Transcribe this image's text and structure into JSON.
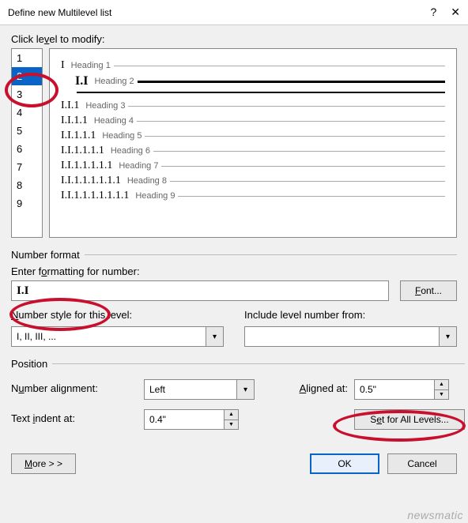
{
  "title": "Define new Multilevel list",
  "level_label_pre": "Click le",
  "level_label_u": "v",
  "level_label_post": "el to modify:",
  "levels": [
    "1",
    "2",
    "3",
    "4",
    "5",
    "6",
    "7",
    "8",
    "9"
  ],
  "selected_level": "2",
  "preview": [
    {
      "indent": 0,
      "num": "I",
      "text": "Heading 1",
      "bold": false,
      "lineBold": false
    },
    {
      "indent": 18,
      "num": "I.I",
      "text": "Heading 2",
      "bold": true,
      "lineBold": true
    },
    {
      "indent": 0,
      "num": "I.I.1",
      "text": "Heading 3",
      "bold": false,
      "lineBold": false
    },
    {
      "indent": 0,
      "num": "I.I.1.1",
      "text": "Heading 4",
      "bold": false,
      "lineBold": false
    },
    {
      "indent": 0,
      "num": "I.I.1.1.1",
      "text": "Heading 5",
      "bold": false,
      "lineBold": false
    },
    {
      "indent": 0,
      "num": "I.I.1.1.1.1",
      "text": "Heading 6",
      "bold": false,
      "lineBold": false
    },
    {
      "indent": 0,
      "num": "I.I.1.1.1.1.1",
      "text": "Heading 7",
      "bold": false,
      "lineBold": false
    },
    {
      "indent": 0,
      "num": "I.I.1.1.1.1.1.1",
      "text": "Heading 8",
      "bold": false,
      "lineBold": false
    },
    {
      "indent": 0,
      "num": "I.I.1.1.1.1.1.1.1",
      "text": "Heading 9",
      "bold": false,
      "lineBold": false
    }
  ],
  "group_number_format": "Number format",
  "enter_formatting_pre": "Enter f",
  "enter_formatting_u": "o",
  "enter_formatting_post": "rmatting for number:",
  "format_value": "I.I",
  "font_u": "F",
  "font_post": "ont...",
  "num_style_u": "N",
  "num_style_post": "umber style for this level:",
  "num_style_value": "I, II, III, ...",
  "include_label": "Include level number from:",
  "include_value": "",
  "group_position": "Position",
  "num_align_label": "Number alignment:",
  "num_align_u": "u",
  "num_align_value": "Left",
  "aligned_u": "A",
  "aligned_post": "ligned at:",
  "aligned_value": "0.5\"",
  "text_indent_label_pre": "Text ",
  "text_indent_u": "i",
  "text_indent_label_post": "ndent at:",
  "text_indent_value": "0.4\"",
  "set_all_u": "e",
  "set_all_pre": "S",
  "set_all_post": "t for All Levels...",
  "more_u": "M",
  "more_post": "ore > >",
  "ok": "OK",
  "cancel": "Cancel",
  "watermark": "newsmatic"
}
